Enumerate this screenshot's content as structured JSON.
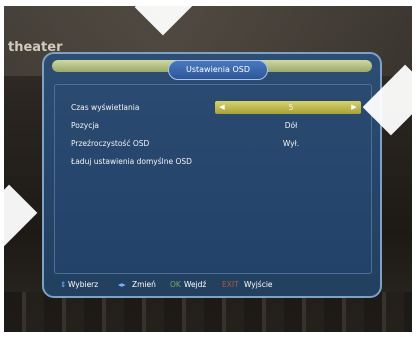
{
  "background": {
    "caption": "theater"
  },
  "osd": {
    "title": "Ustawienia OSD",
    "menu": [
      {
        "label": "Czas wyświetlania",
        "value": "5",
        "selected": true
      },
      {
        "label": "Pozycja",
        "value": "Dół",
        "selected": false
      },
      {
        "label": "Przeźroczystość OSD",
        "value": "Wył.",
        "selected": false
      },
      {
        "label": "Ładuj ustawienia domyślne OSD",
        "value": "",
        "selected": false
      }
    ],
    "arrows": {
      "left": "◀",
      "right": "▶"
    },
    "footer": {
      "select_key": "⇕",
      "select_label": "Wybierz",
      "change_key": "◂▸",
      "change_label": "Zmień",
      "ok_key": "OK",
      "ok_label": "Wejdź",
      "exit_key": "EXIT",
      "exit_label": "Wyjście"
    }
  },
  "colors": {
    "panel": "#26456a",
    "highlight": "#c9c35a",
    "title_pill": "#3d69b0"
  }
}
